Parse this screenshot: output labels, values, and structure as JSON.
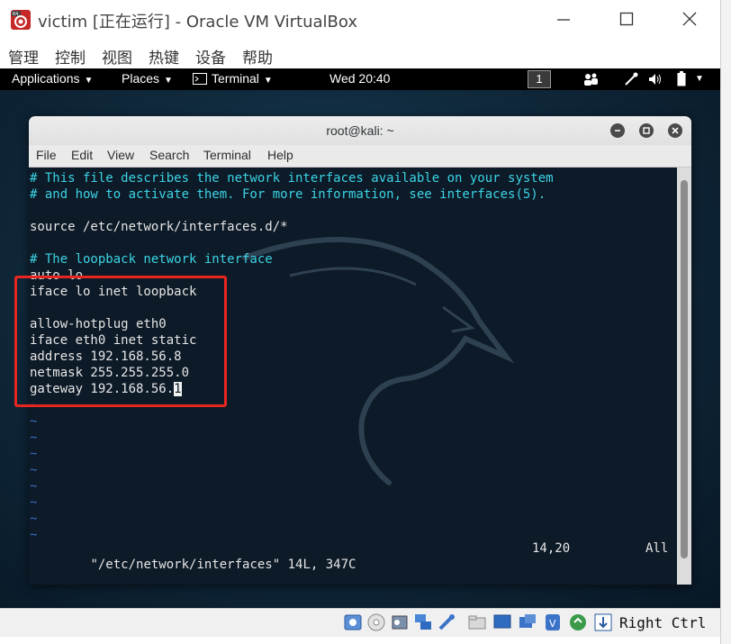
{
  "vbox": {
    "title": "victim [正在运行] - Oracle VM VirtualBox",
    "menu": [
      "管理",
      "控制",
      "视图",
      "热键",
      "设备",
      "帮助"
    ],
    "host_key": "Right Ctrl"
  },
  "topbar": {
    "applications": "Applications",
    "places": "Places",
    "terminal": "Terminal",
    "clock": "Wed 20:40",
    "workspace": "1"
  },
  "terminal": {
    "title": "root@kali: ~",
    "menu": [
      "File",
      "Edit",
      "View",
      "Search",
      "Terminal",
      "Help"
    ],
    "lines": [
      "# This file describes the network interfaces available on your system",
      "# and how to activate them. For more information, see interfaces(5).",
      "",
      "source /etc/network/interfaces.d/*",
      "",
      "# The loopback network interface",
      "auto lo",
      "iface lo inet loopback",
      "",
      "allow-hotplug eth0",
      "iface eth0 inet static",
      "address 192.168.56.8",
      "netmask 255.255.255.0",
      "gateway 192.168.56.",
      "~",
      "~",
      "~",
      "~",
      "~",
      "~",
      "~",
      "~",
      "~"
    ],
    "cursor_char": "1",
    "status_file": "\"/etc/network/interfaces\" 14L, 347C",
    "status_pos": "14,20",
    "status_pct": "All"
  },
  "colors": {
    "highlight_box": "#e8261f",
    "comment": "#3bd4e6",
    "tilde": "#3a6fc4"
  },
  "icons": [
    "vbox-app-icon",
    "minimize-icon",
    "maximize-icon",
    "close-icon",
    "terminal-icon",
    "users-icon",
    "network-icon",
    "volume-icon",
    "battery-icon",
    "power-caret-icon"
  ]
}
